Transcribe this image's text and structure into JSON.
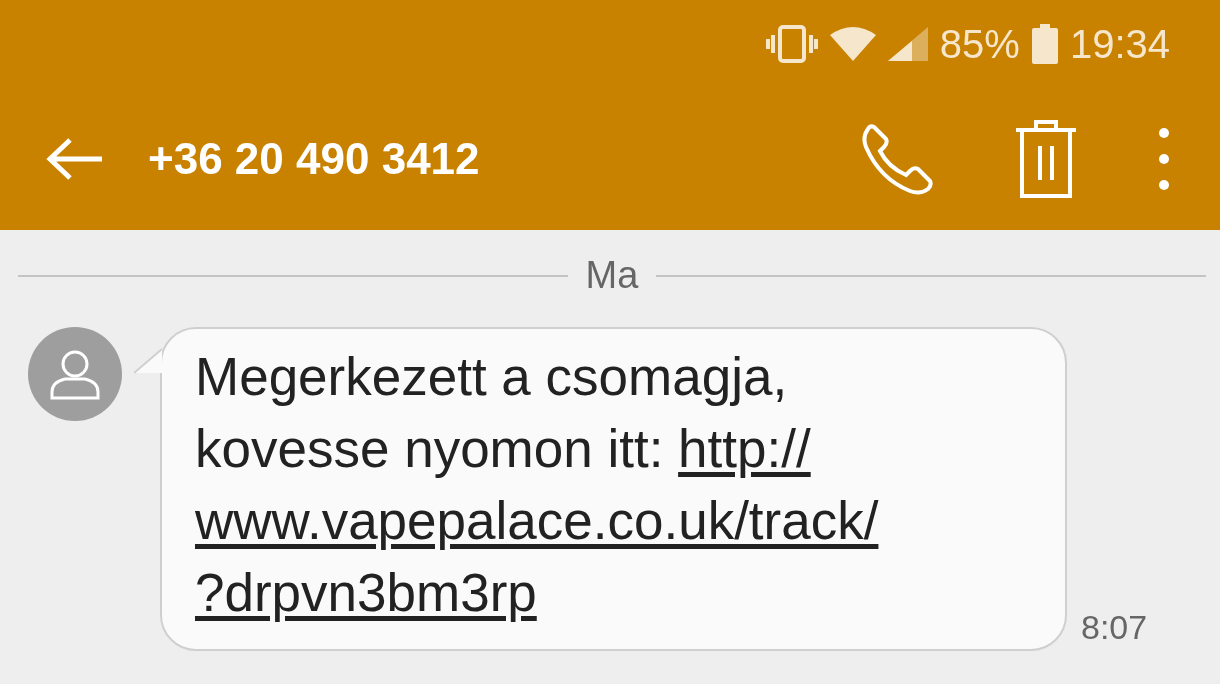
{
  "status_bar": {
    "battery": "85%",
    "time": "19:34"
  },
  "app_bar": {
    "title": "+36 20 490 3412"
  },
  "date_divider": "Ma",
  "messages": [
    {
      "text": "Megerkezett a csomagja, kovesse nyomon itt:",
      "link_lines": [
        "http://",
        "www.vapepalace.co.uk/track/",
        "?drpvn3bm3rp"
      ],
      "time": "8:07"
    }
  ]
}
